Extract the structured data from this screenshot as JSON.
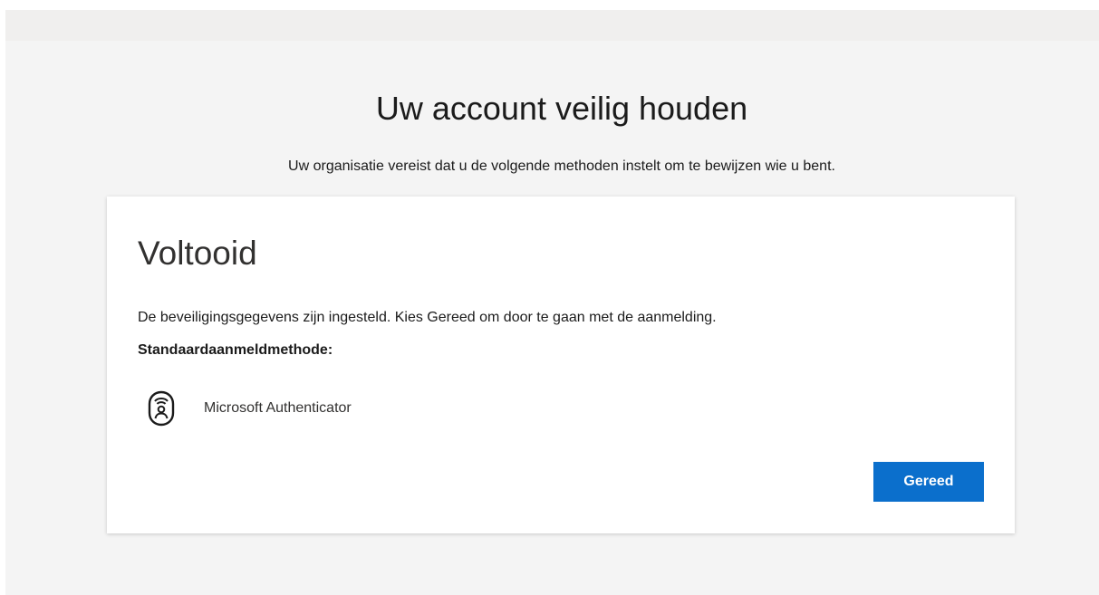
{
  "header": {
    "title": "Uw account veilig houden",
    "subtitle": "Uw organisatie vereist dat u de volgende methoden instelt om te bewijzen wie u bent."
  },
  "card": {
    "title": "Voltooid",
    "message": "De beveiligingsgegevens zijn ingesteld. Kies Gereed om door te gaan met de aanmelding.",
    "default_method_label": "Standaardaanmeldmethode:",
    "method": {
      "icon": "authenticator-lock-icon",
      "name": "Microsoft Authenticator"
    },
    "done_button_label": "Gereed"
  },
  "colors": {
    "page_background": "#f4f4f4",
    "top_bar": "#f0efee",
    "card_background": "#ffffff",
    "accent": "#0b6fcc"
  }
}
